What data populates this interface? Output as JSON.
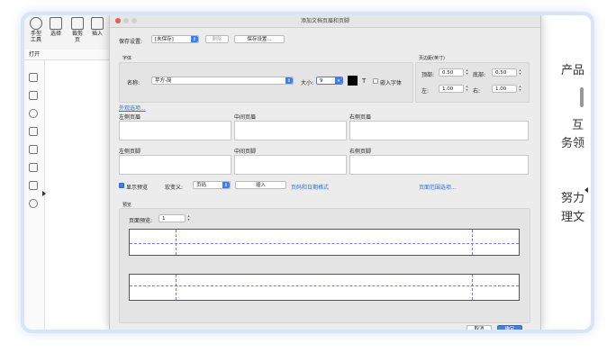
{
  "toolbar": {
    "hand_label": "手型\n工具",
    "select_label": "选择",
    "crop_label": "裁剪\n页",
    "insert_label": "插入",
    "open_label": "打开"
  },
  "document": {
    "text_lines": [
      "产品",
      "互",
      "务领",
      "努力",
      "理文"
    ]
  },
  "dialog": {
    "title": "添加文档页眉和页脚",
    "saved_settings_label": "保存设置:",
    "saved_settings_value": "[未保存]",
    "delete_label": "删除",
    "save_settings_label": "保存设置...",
    "font_section_label": "字体",
    "font_name_label": "名称:",
    "font_name_value": "苹方-简",
    "size_label": "大小:",
    "size_value": "9",
    "embed_font_label": "嵌入字体",
    "margin_section_label": "页边距(英寸)",
    "top_label": "顶部:",
    "top_value": "0.50",
    "bottom_label": "底部:",
    "bottom_value": "0.50",
    "left_label": "左:",
    "left_value": "1.00",
    "right_label": "右:",
    "right_value": "1.00",
    "appearance_link": "外观选项...",
    "left_header_label": "左侧页眉",
    "center_header_label": "中间页眉",
    "right_header_label": "右侧页眉",
    "left_footer_label": "左侧页脚",
    "center_footer_label": "中间页脚",
    "right_footer_label": "右侧页脚",
    "show_preview_label": "显示预览",
    "macro_label": "宏变义:",
    "macro_value": "页码",
    "insert_label": "插入",
    "page_date_format_link": "页码和日期格式",
    "page_range_link": "页面范围选项...",
    "preview_section_label": "预览",
    "preview_page_label": "页面预览:",
    "preview_page_value": "1",
    "cancel_label": "取消",
    "ok_label": "确定"
  },
  "colors": {
    "accent": "#3d7ef3",
    "text_color_swatch": "#000000"
  }
}
